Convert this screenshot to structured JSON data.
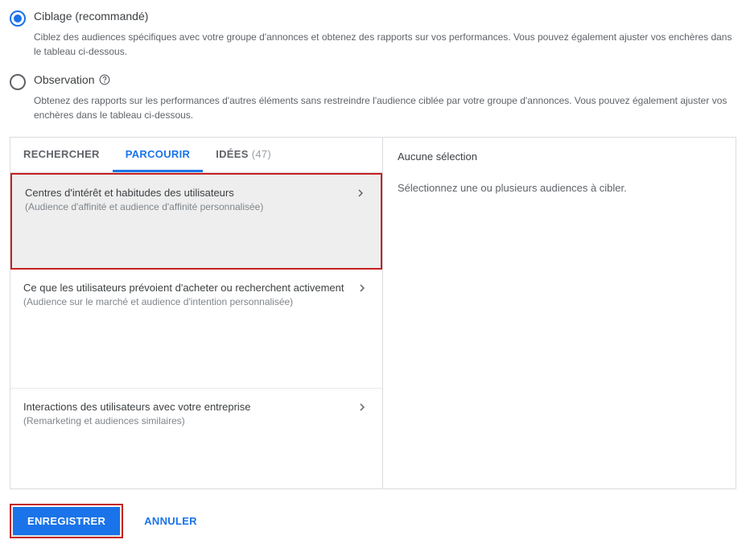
{
  "radio_options": {
    "targeting": {
      "label": "Ciblage (recommandé)",
      "description": "Ciblez des audiences spécifiques avec votre groupe d'annonces et obtenez des rapports sur vos performances. Vous pouvez également ajuster vos enchères dans le tableau ci-dessous."
    },
    "observation": {
      "label": "Observation",
      "description": "Obtenez des rapports sur les performances d'autres éléments sans restreindre l'audience ciblée par votre groupe d'annonces. Vous pouvez également ajuster vos enchères dans le tableau ci-dessous."
    }
  },
  "tabs": {
    "search": "RECHERCHER",
    "browse": "PARCOURIR",
    "ideas_label": "IDÉES",
    "ideas_count": "(47)"
  },
  "right_panel": {
    "header": "Aucune sélection",
    "hint": "Sélectionnez une ou plusieurs audiences à cibler."
  },
  "list": {
    "interests": {
      "title": "Centres d'intérêt et habitudes des utilisateurs",
      "subtitle": "(Audience d'affinité et audience d'affinité personnalisée)"
    },
    "market": {
      "title": "Ce que les utilisateurs prévoient d'acheter ou recherchent activement",
      "subtitle": "(Audience sur le marché et audience d'intention personnalisée)"
    },
    "remarketing": {
      "title": "Interactions des utilisateurs avec votre entreprise",
      "subtitle": "(Remarketing et audiences similaires)"
    }
  },
  "buttons": {
    "save": "ENREGISTRER",
    "cancel": "ANNULER"
  }
}
